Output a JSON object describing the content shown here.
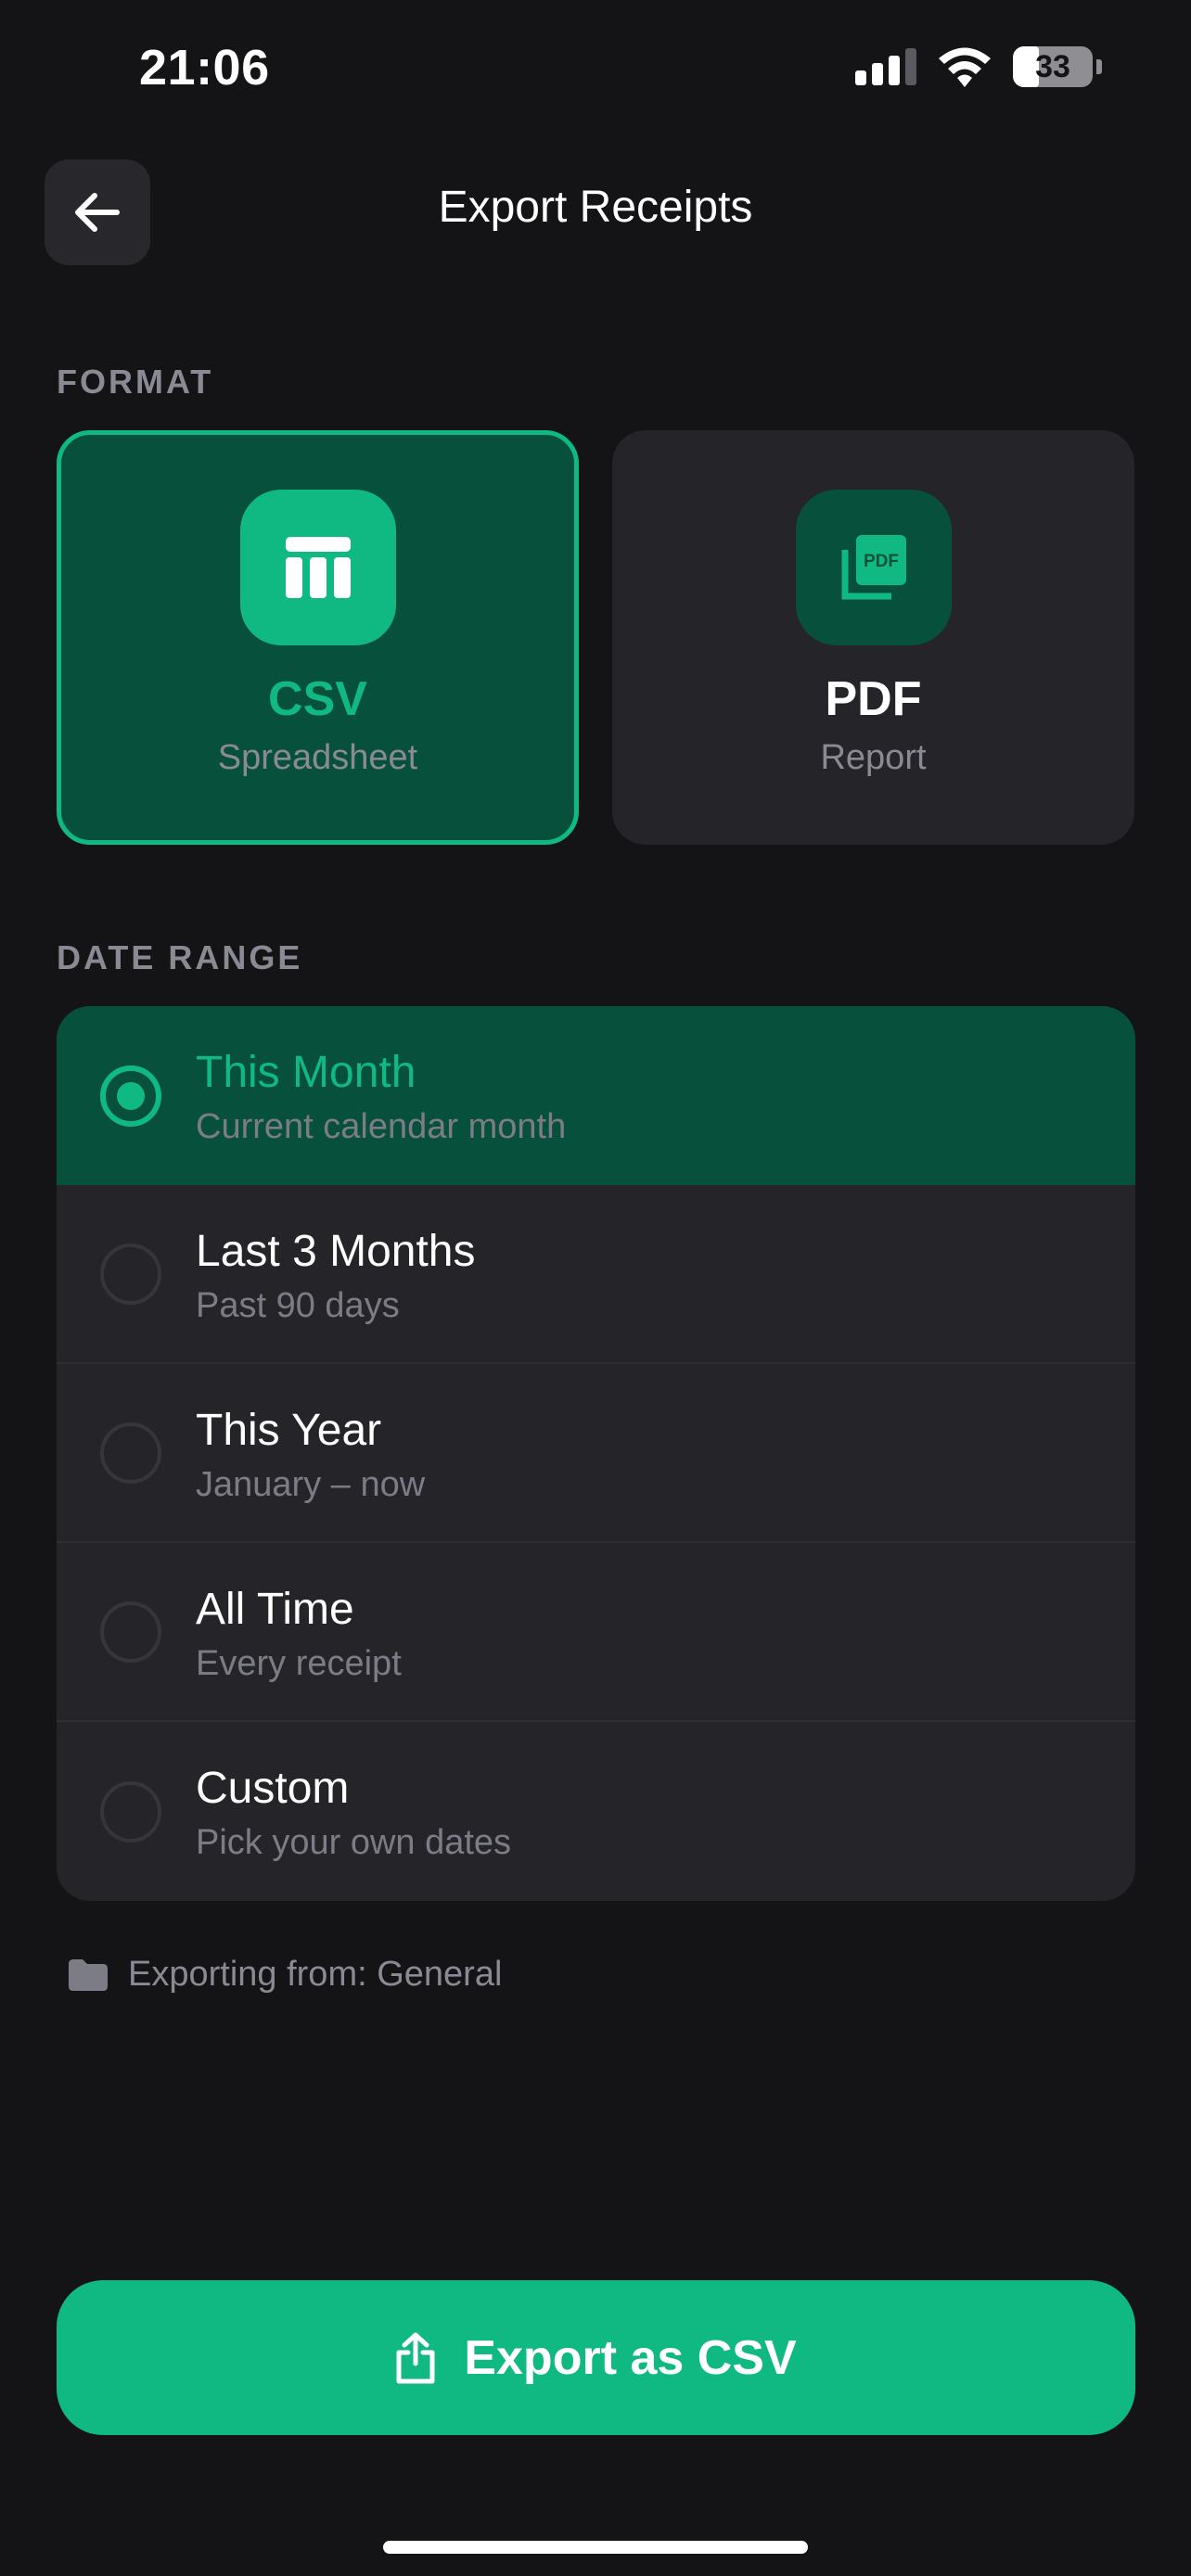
{
  "status_bar": {
    "time": "21:06",
    "battery": "33"
  },
  "header": {
    "title": "Export Receipts"
  },
  "format": {
    "label": "FORMAT",
    "options": [
      {
        "name": "CSV",
        "sub": "Spreadsheet",
        "selected": true,
        "icon": "table-icon"
      },
      {
        "name": "PDF",
        "sub": "Report",
        "selected": false,
        "icon": "pdf-file-icon"
      }
    ]
  },
  "date_range": {
    "label": "DATE RANGE",
    "options": [
      {
        "title": "This Month",
        "sub": "Current calendar month",
        "selected": true
      },
      {
        "title": "Last 3 Months",
        "sub": "Past 90 days",
        "selected": false
      },
      {
        "title": "This Year",
        "sub": "January – now",
        "selected": false
      },
      {
        "title": "All Time",
        "sub": "Every receipt",
        "selected": false
      },
      {
        "title": "Custom",
        "sub": "Pick your own dates",
        "selected": false
      }
    ]
  },
  "note": {
    "text": "Exporting from: General",
    "icon": "folder-icon"
  },
  "export_button": {
    "label": "Export as CSV",
    "icon": "share-icon"
  },
  "colors": {
    "accent": "#10b981",
    "selected_bg": "#07503b",
    "card_bg": "#252529",
    "background": "#141416"
  }
}
